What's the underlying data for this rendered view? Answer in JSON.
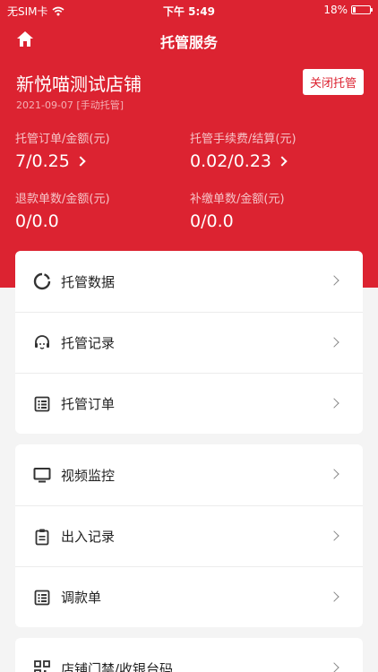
{
  "status_bar": {
    "carrier": "无SIM卡",
    "time": "下午 5:49",
    "battery": "18%",
    "battery_level": 0.18
  },
  "nav": {
    "title": "托管服务",
    "home_icon": "home-icon"
  },
  "store": {
    "name": "新悦喵测试店铺",
    "meta": "2021-09-07 [手动托管]",
    "close_label": "关闭托管"
  },
  "stats": [
    {
      "label": "托管订单/金额(元)",
      "value": "7/0.25",
      "arrow": true
    },
    {
      "label": "托管手续费/结算(元)",
      "value": "0.02/0.23",
      "arrow": true
    },
    {
      "label": "退款单数/金额(元)",
      "value": "0/0.0",
      "arrow": false
    },
    {
      "label": "补缴单数/金额(元)",
      "value": "0/0.0",
      "arrow": false
    }
  ],
  "menu_group_1": [
    {
      "label": "托管数据",
      "icon": "donut-chart-icon"
    },
    {
      "label": "托管记录",
      "icon": "headset-icon"
    },
    {
      "label": "托管订单",
      "icon": "list-icon"
    }
  ],
  "menu_group_2": [
    {
      "label": "视频监控",
      "icon": "monitor-icon"
    },
    {
      "label": "出入记录",
      "icon": "clipboard-icon"
    },
    {
      "label": "调款单",
      "icon": "list-icon"
    }
  ],
  "menu_group_3": [
    {
      "label": "店铺门禁/收银台码",
      "icon": "qr-code-icon"
    }
  ],
  "colors": {
    "brand_red": "#dc2331",
    "background": "#f4f4f4"
  }
}
